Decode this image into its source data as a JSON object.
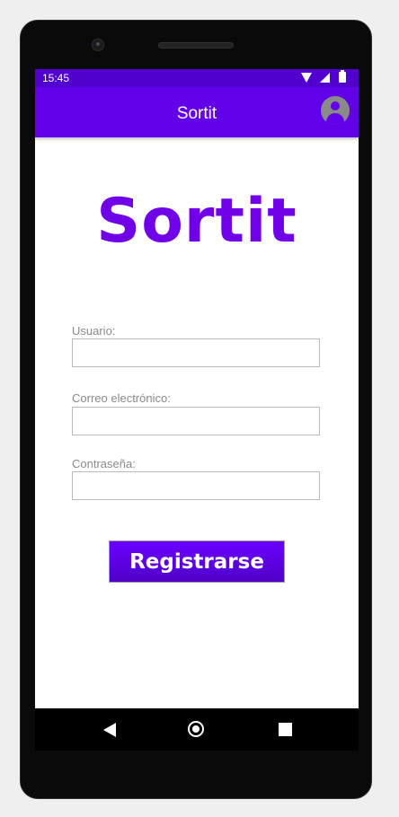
{
  "status_bar": {
    "time": "15:45",
    "icons": [
      "wifi-icon",
      "signal-icon",
      "battery-icon"
    ]
  },
  "app_bar": {
    "title": "Sortit",
    "account_icon": "account-circle-icon"
  },
  "logo": {
    "text": "Sortit"
  },
  "form": {
    "username": {
      "label": "Usuario:",
      "value": "",
      "placeholder": ""
    },
    "email": {
      "label": "Correo electrónico:",
      "value": "",
      "placeholder": ""
    },
    "password": {
      "label": "Contraseña:",
      "value": "",
      "placeholder": ""
    },
    "register_label": "Registrarse"
  },
  "nav_bar": {
    "icons": [
      "back-icon",
      "home-icon",
      "recents-icon"
    ]
  },
  "colors": {
    "status_bar": "#5200cf",
    "app_bar": "#6200ea",
    "logo": "#7000e8",
    "button": "#6200ea"
  }
}
